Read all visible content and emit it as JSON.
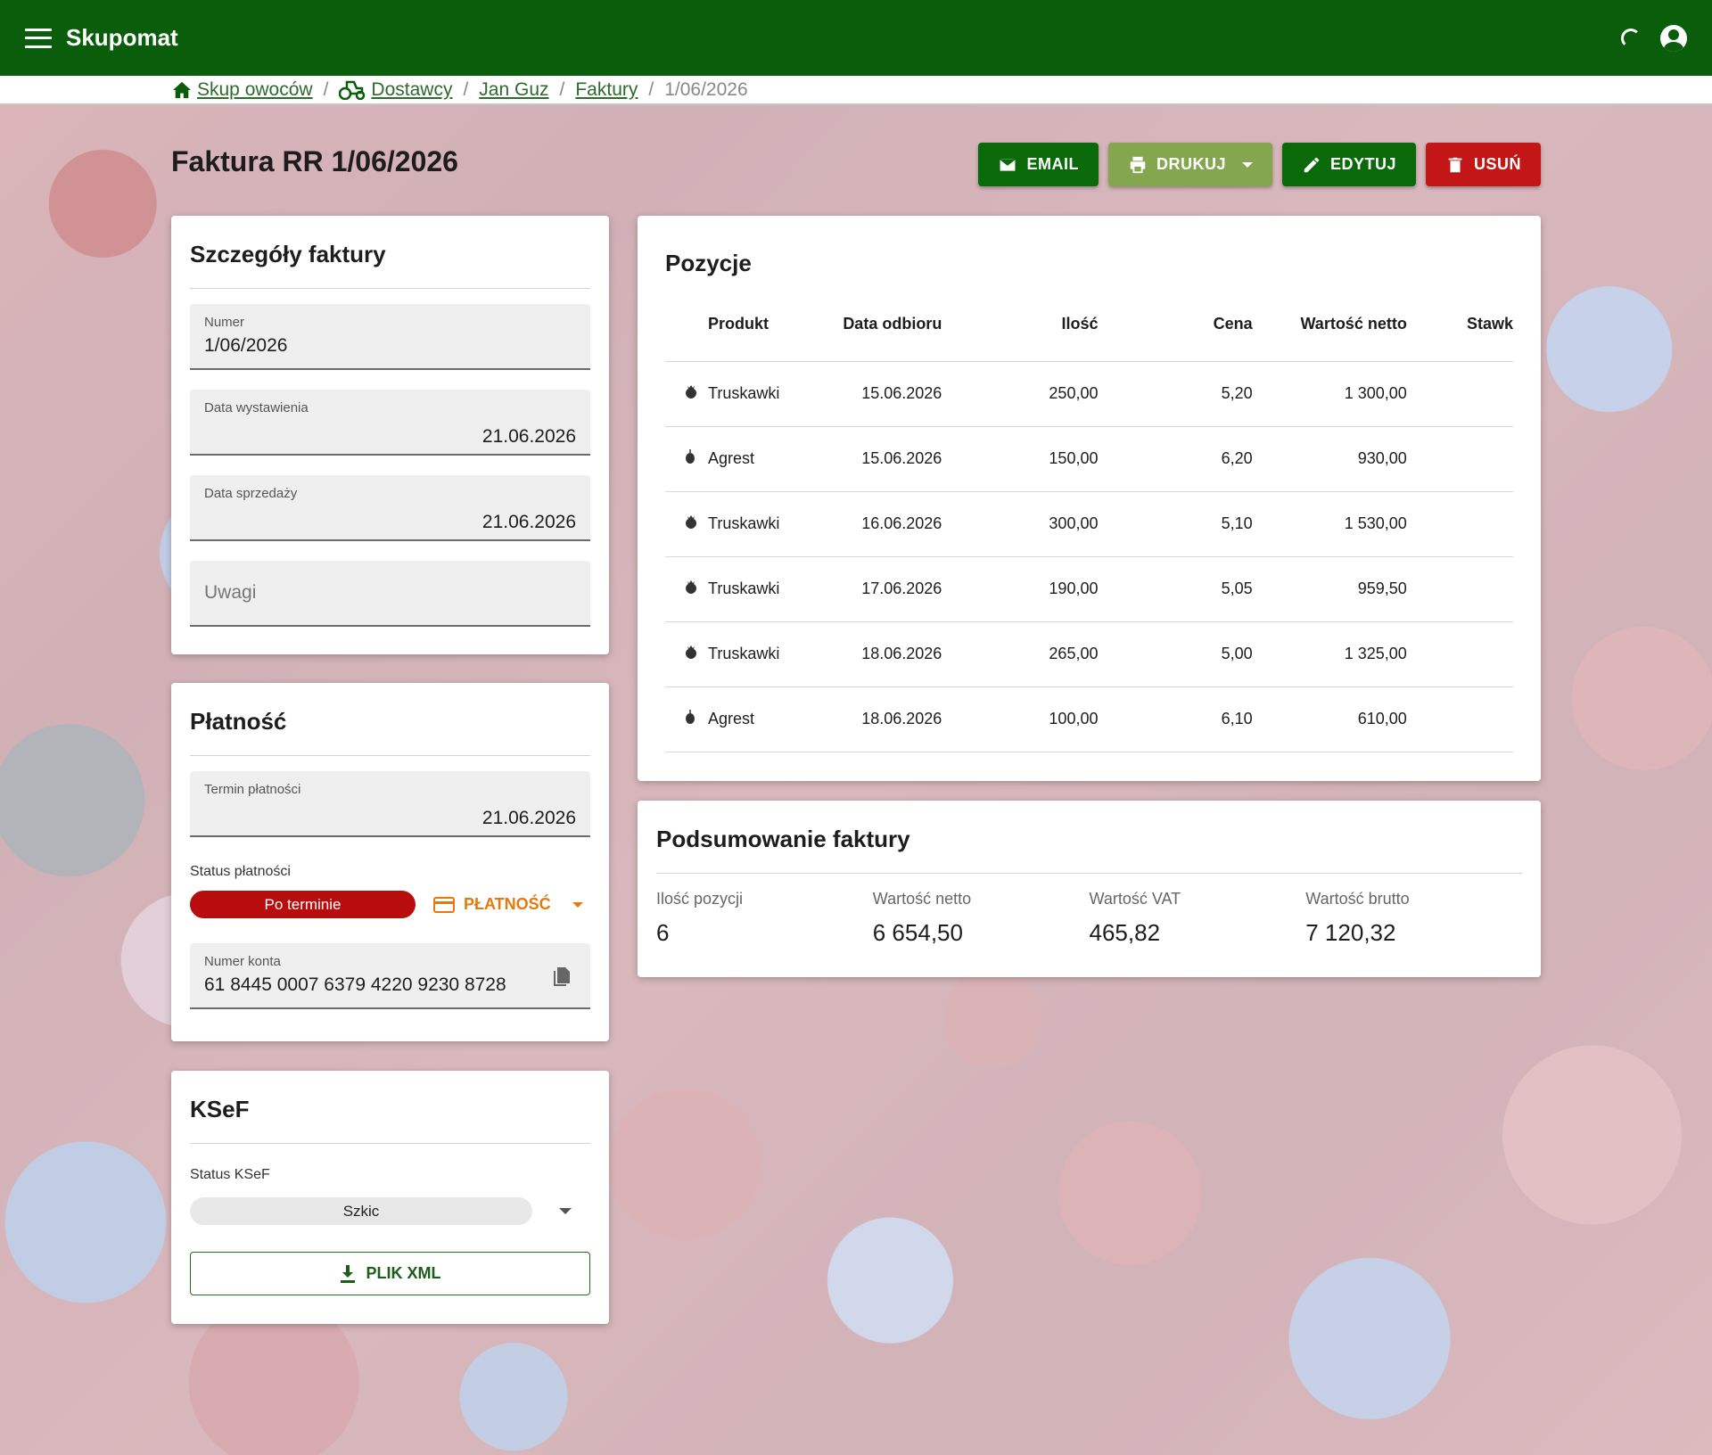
{
  "app": {
    "title": "Skupomat"
  },
  "breadcrumb": {
    "items": [
      {
        "label": "Skup owoców",
        "icon": "home-icon"
      },
      {
        "label": "Dostawcy",
        "icon": "tractor-icon"
      },
      {
        "label": "Jan Guz"
      },
      {
        "label": "Faktury"
      }
    ],
    "current": "1/06/2026",
    "separator": "/"
  },
  "page": {
    "title": "Faktura RR 1/06/2026"
  },
  "actions": {
    "email": "EMAIL",
    "print": "DRUKUJ",
    "edit": "EDYTUJ",
    "delete": "USUŃ"
  },
  "details": {
    "title": "Szczegóły faktury",
    "number": {
      "label": "Numer",
      "value": "1/06/2026"
    },
    "issue_date": {
      "label": "Data wystawienia",
      "value": "21.06.2026"
    },
    "sale_date": {
      "label": "Data sprzedaży",
      "value": "21.06.2026"
    },
    "notes": {
      "placeholder": "Uwagi"
    }
  },
  "payment": {
    "title": "Płatność",
    "due_date": {
      "label": "Termin płatności",
      "value": "21.06.2026"
    },
    "status_label": "Status płatności",
    "status_value": "Po terminie",
    "pay_button": "PŁATNOŚĆ",
    "account": {
      "label": "Numer konta",
      "value": "61 8445 0007 6379 4220 9230 8728"
    }
  },
  "ksef": {
    "title": "KSeF",
    "status_label": "Status KSeF",
    "status_value": "Szkic",
    "xml_button": "PLIK XML"
  },
  "positions": {
    "title": "Pozycje",
    "headers": [
      "Produkt",
      "Data odbioru",
      "Ilość",
      "Cena",
      "Wartość netto",
      "Stawk"
    ],
    "rows": [
      {
        "icon": "strawberry-icon",
        "product": "Truskawki",
        "date": "15.06.2026",
        "qty": "250,00",
        "price": "5,20",
        "net": "1 300,00"
      },
      {
        "icon": "gooseberry-icon",
        "product": "Agrest",
        "date": "15.06.2026",
        "qty": "150,00",
        "price": "6,20",
        "net": "930,00"
      },
      {
        "icon": "strawberry-icon",
        "product": "Truskawki",
        "date": "16.06.2026",
        "qty": "300,00",
        "price": "5,10",
        "net": "1 530,00"
      },
      {
        "icon": "strawberry-icon",
        "product": "Truskawki",
        "date": "17.06.2026",
        "qty": "190,00",
        "price": "5,05",
        "net": "959,50"
      },
      {
        "icon": "strawberry-icon",
        "product": "Truskawki",
        "date": "18.06.2026",
        "qty": "265,00",
        "price": "5,00",
        "net": "1 325,00"
      },
      {
        "icon": "gooseberry-icon",
        "product": "Agrest",
        "date": "18.06.2026",
        "qty": "100,00",
        "price": "6,10",
        "net": "610,00"
      }
    ]
  },
  "summary": {
    "title": "Podsumowanie faktury",
    "items": [
      {
        "label": "Ilość pozycji",
        "value": "6"
      },
      {
        "label": "Wartość netto",
        "value": "6 654,50"
      },
      {
        "label": "Wartość VAT",
        "value": "465,82"
      },
      {
        "label": "Wartość brutto",
        "value": "7 120,32"
      }
    ]
  },
  "colors": {
    "appbar": "#0a5d0a",
    "primary_button": "#0a6a0a",
    "print_button": "#84a64f",
    "danger": "#c31717",
    "warning": "#e8780c"
  }
}
